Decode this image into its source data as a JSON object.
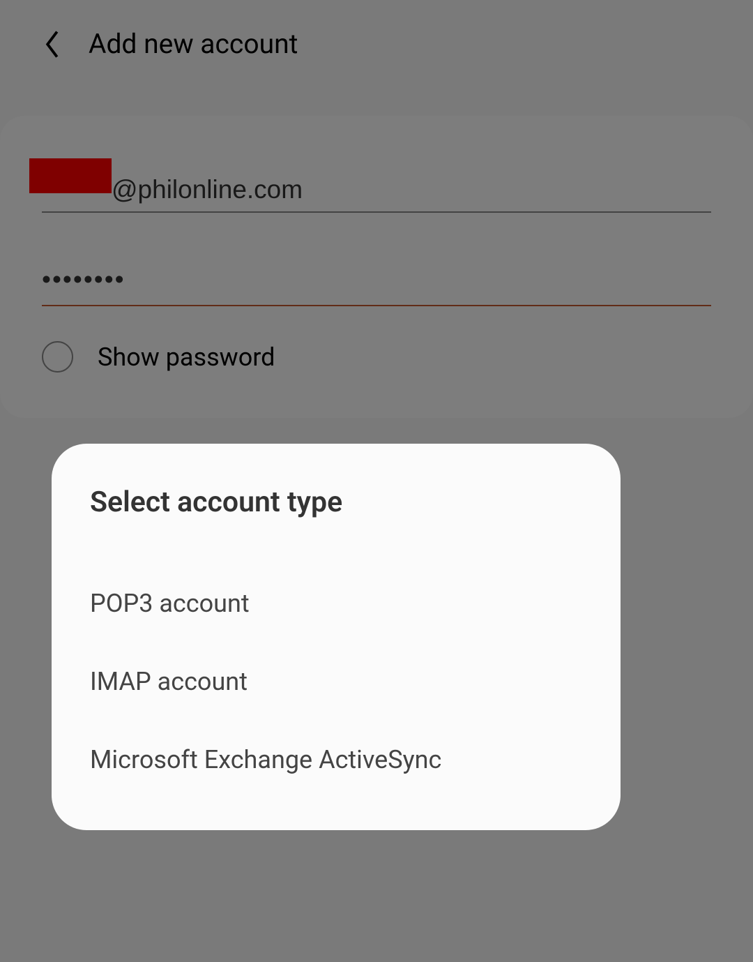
{
  "header": {
    "title": "Add new account"
  },
  "form": {
    "email_value": "@philonline.com",
    "password_value": "••••••••",
    "show_password_label": "Show password"
  },
  "dialog": {
    "title": "Select account type",
    "options": [
      {
        "label": "POP3 account"
      },
      {
        "label": "IMAP account"
      },
      {
        "label": "Microsoft Exchange ActiveSync"
      }
    ]
  }
}
